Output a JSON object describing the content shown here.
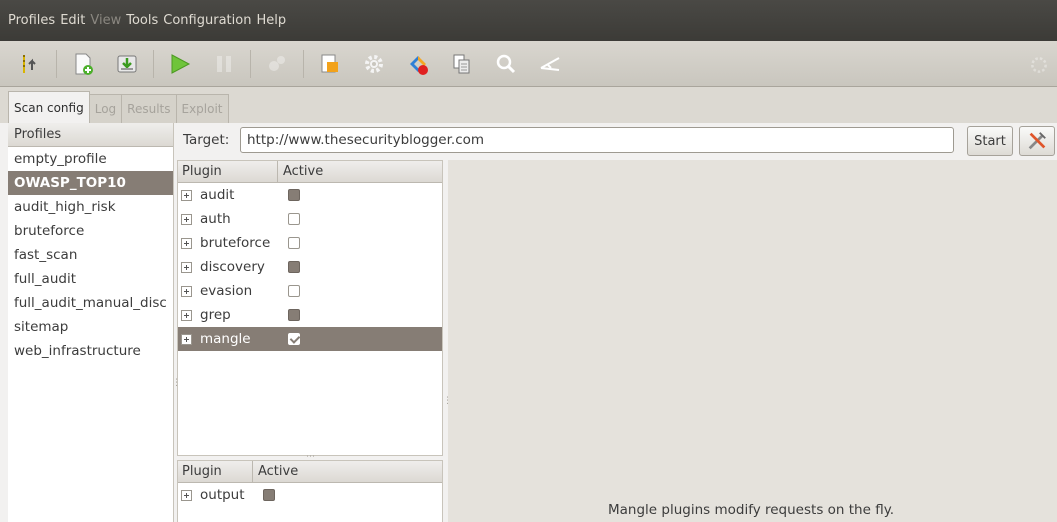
{
  "menubar": {
    "items": [
      {
        "label": "Profiles",
        "enabled": true
      },
      {
        "label": "Edit",
        "enabled": true
      },
      {
        "label": "View",
        "enabled": false
      },
      {
        "label": "Tools",
        "enabled": true
      },
      {
        "label": "Configuration",
        "enabled": true
      },
      {
        "label": "Help",
        "enabled": true
      }
    ]
  },
  "toolbar": {
    "icons": [
      "wizard-icon",
      "new-profile-icon",
      "save-profile-icon",
      "play-icon",
      "pause-icon",
      "stop-icon",
      "edit-icon",
      "settings-icon",
      "compare-icon",
      "export-icon",
      "search-icon",
      "proxy-icon"
    ]
  },
  "tabs": [
    {
      "label": "Scan config",
      "active": true
    },
    {
      "label": "Log",
      "active": false
    },
    {
      "label": "Results",
      "active": false
    },
    {
      "label": "Exploit",
      "active": false
    }
  ],
  "profiles": {
    "header": "Profiles",
    "items": [
      {
        "label": "empty_profile",
        "selected": false
      },
      {
        "label": "OWASP_TOP10",
        "selected": true
      },
      {
        "label": "audit_high_risk",
        "selected": false
      },
      {
        "label": "bruteforce",
        "selected": false
      },
      {
        "label": "fast_scan",
        "selected": false
      },
      {
        "label": "full_audit",
        "selected": false
      },
      {
        "label": "full_audit_manual_disc",
        "selected": false
      },
      {
        "label": "sitemap",
        "selected": false
      },
      {
        "label": "web_infrastructure",
        "selected": false
      }
    ]
  },
  "target": {
    "label": "Target:",
    "value": "http://www.thesecurityblogger.com"
  },
  "start_button": "Start",
  "plugins_top": {
    "col_plugin": "Plugin",
    "col_active": "Active",
    "rows": [
      {
        "name": "audit",
        "state": "partial"
      },
      {
        "name": "auth",
        "state": "off"
      },
      {
        "name": "bruteforce",
        "state": "off"
      },
      {
        "name": "discovery",
        "state": "partial"
      },
      {
        "name": "evasion",
        "state": "off"
      },
      {
        "name": "grep",
        "state": "partial"
      },
      {
        "name": "mangle",
        "state": "checked"
      }
    ]
  },
  "plugins_bottom": {
    "col_plugin": "Plugin",
    "col_active": "Active",
    "rows": [
      {
        "name": "output",
        "state": "partial"
      }
    ]
  },
  "description": "Mangle plugins modify requests on the fly."
}
